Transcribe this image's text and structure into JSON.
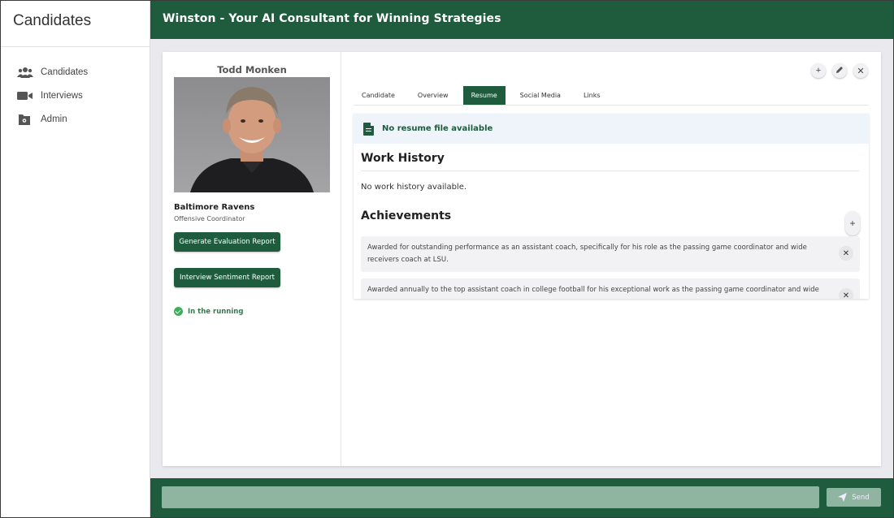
{
  "sidebar": {
    "title": "Candidates",
    "items": [
      {
        "label": "Candidates",
        "icon": "users-icon"
      },
      {
        "label": "Interviews",
        "icon": "video-camera-icon"
      },
      {
        "label": "Admin",
        "icon": "gear-folder-icon"
      }
    ]
  },
  "header": {
    "title": "Winston - Your AI Consultant for Winning Strategies"
  },
  "candidate": {
    "name": "Todd Monken",
    "team": "Baltimore Ravens",
    "role": "Offensive Coordinator",
    "eval_button": "Generate Evaluation Report",
    "sentiment_button": "Interview Sentiment Report",
    "status": "In the running"
  },
  "tabs": [
    {
      "label": "Candidate",
      "active": false
    },
    {
      "label": "Overview",
      "active": false
    },
    {
      "label": "Resume",
      "active": true
    },
    {
      "label": "Social Media",
      "active": false
    },
    {
      "label": "Links",
      "active": false
    }
  ],
  "resume": {
    "no_file": "No resume file available",
    "work_history_title": "Work History",
    "no_work_history": "No work history available.",
    "achievements_title": "Achievements",
    "achievements": [
      "Awarded for outstanding performance as an assistant coach, specifically for his role as the passing game coordinator and wide receivers coach at LSU.",
      "Awarded annually to the top assistant coach in college football for his exceptional work as the passing game coordinator and wide"
    ]
  },
  "footer": {
    "input_value": "",
    "input_placeholder": "",
    "send_label": "Send"
  },
  "colors": {
    "brand_green": "#1f5c3e",
    "footer_input": "#8fb5a0",
    "status_green": "#3dae5a"
  }
}
